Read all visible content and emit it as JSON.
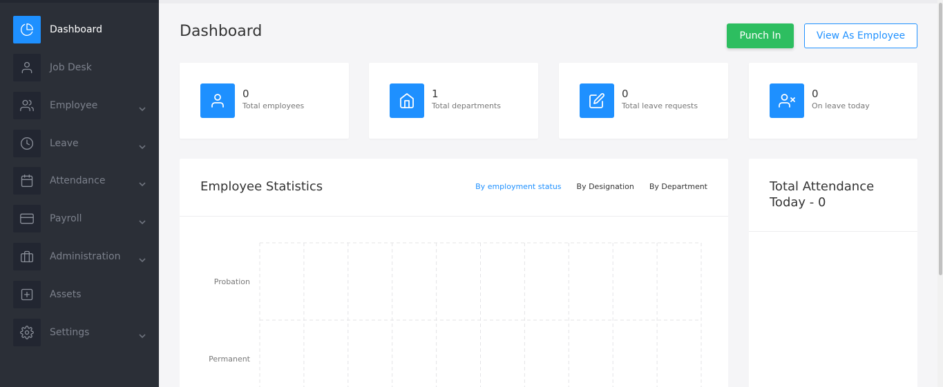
{
  "sidebar": {
    "items": [
      {
        "label": "Dashboard",
        "icon": "pie-chart-icon",
        "active": true,
        "has_submenu": false
      },
      {
        "label": "Job Desk",
        "icon": "user-icon",
        "active": false,
        "has_submenu": false
      },
      {
        "label": "Employee",
        "icon": "users-icon",
        "active": false,
        "has_submenu": true
      },
      {
        "label": "Leave",
        "icon": "clock-icon",
        "active": false,
        "has_submenu": true
      },
      {
        "label": "Attendance",
        "icon": "calendar-icon",
        "active": false,
        "has_submenu": true
      },
      {
        "label": "Payroll",
        "icon": "credit-card-icon",
        "active": false,
        "has_submenu": true
      },
      {
        "label": "Administration",
        "icon": "briefcase-icon",
        "active": false,
        "has_submenu": true
      },
      {
        "label": "Assets",
        "icon": "plus-square-icon",
        "active": false,
        "has_submenu": false
      },
      {
        "label": "Settings",
        "icon": "gear-icon",
        "active": false,
        "has_submenu": true
      }
    ]
  },
  "header": {
    "title": "Dashboard",
    "punch_in_label": "Punch In",
    "view_as_employee_label": "View As Employee"
  },
  "stats": [
    {
      "value": "0",
      "label": "Total employees",
      "icon": "user-icon"
    },
    {
      "value": "1",
      "label": "Total departments",
      "icon": "home-icon"
    },
    {
      "value": "0",
      "label": "Total leave requests",
      "icon": "edit-icon"
    },
    {
      "value": "0",
      "label": "On leave today",
      "icon": "user-x-icon"
    }
  ],
  "employee_statistics": {
    "title": "Employee Statistics",
    "tabs": [
      {
        "label": "By employment status",
        "active": true
      },
      {
        "label": "By Designation",
        "active": false
      },
      {
        "label": "By Department",
        "active": false
      }
    ]
  },
  "attendance": {
    "title": "Total Attendance Today - 0"
  },
  "chart_data": {
    "type": "bar",
    "orientation": "horizontal",
    "categories": [
      "Probation",
      "Permanent"
    ],
    "values": [
      0,
      0
    ],
    "title": "",
    "xlabel": "",
    "ylabel": "",
    "grid": true
  },
  "colors": {
    "accent": "#1e90ff",
    "success": "#2dbe60",
    "sidebar_bg": "#2b2f37"
  }
}
